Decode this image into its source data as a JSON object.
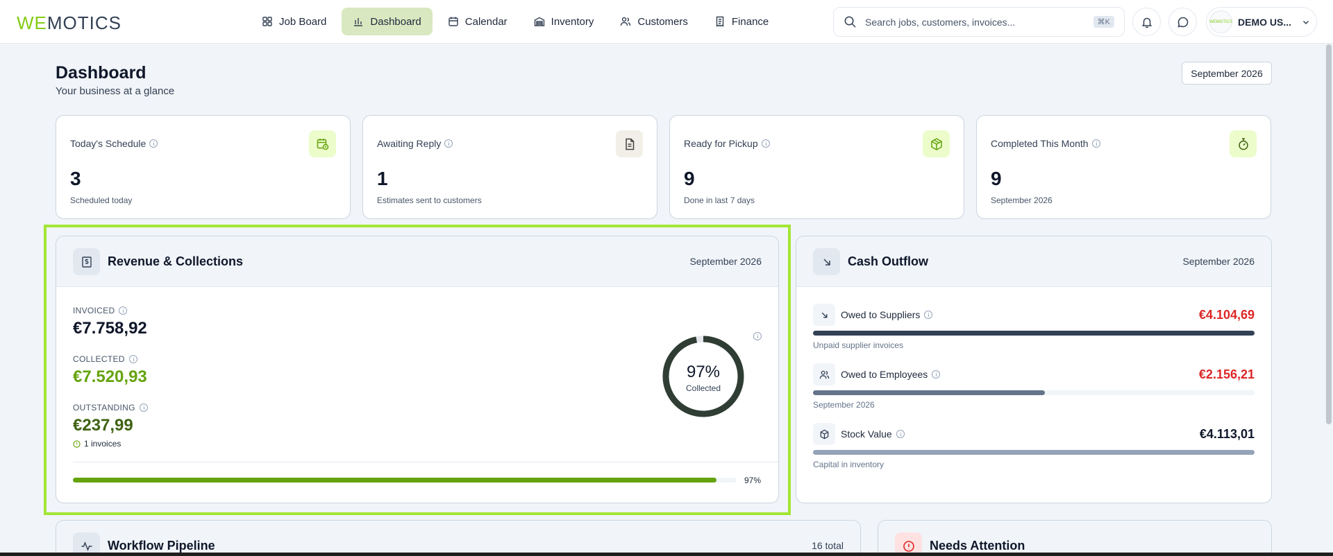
{
  "brand": {
    "logo_we": "WE",
    "logo_rest": "MOTICS",
    "accent": "#84cc16"
  },
  "nav": [
    {
      "label": "Job Board",
      "icon": "grid-icon",
      "active": false
    },
    {
      "label": "Dashboard",
      "icon": "bar-chart-icon",
      "active": true
    },
    {
      "label": "Calendar",
      "icon": "calendar-icon",
      "active": false
    },
    {
      "label": "Inventory",
      "icon": "warehouse-icon",
      "active": false
    },
    {
      "label": "Customers",
      "icon": "users-icon",
      "active": false
    },
    {
      "label": "Finance",
      "icon": "receipt-icon",
      "active": false
    }
  ],
  "search": {
    "placeholder": "Search jobs, customers, invoices...",
    "shortcut": "⌘K"
  },
  "user": {
    "name": "DEMO US...",
    "avatar_text": "WEMOTICS"
  },
  "header": {
    "title": "Dashboard",
    "subtitle": "Your business at a glance",
    "month": "September 2026"
  },
  "stats": [
    {
      "label": "Today's Schedule",
      "value": "3",
      "sub": "Scheduled today",
      "icon": "calendar-clock-icon",
      "icon_bg": "#ecfccb",
      "icon_color": "#65a30d"
    },
    {
      "label": "Awaiting Reply",
      "value": "1",
      "sub": "Estimates sent to customers",
      "icon": "document-icon",
      "icon_bg": "#f1efe8",
      "icon_color": "#44403c"
    },
    {
      "label": "Ready for Pickup",
      "value": "9",
      "sub": "Done in last 7 days",
      "icon": "package-icon",
      "icon_bg": "#ecfccb",
      "icon_color": "#65a30d"
    },
    {
      "label": "Completed This Month",
      "value": "9",
      "sub": "September 2026",
      "icon": "timer-icon",
      "icon_bg": "#ecfccb",
      "icon_color": "#3f6212"
    }
  ],
  "revenue": {
    "title": "Revenue & Collections",
    "period": "September 2026",
    "invoiced_label": "INVOICED",
    "invoiced_value": "€7.758,92",
    "collected_label": "COLLECTED",
    "collected_value": "€7.520,93",
    "outstanding_label": "OUTSTANDING",
    "outstanding_value": "€237,99",
    "outstanding_note": "1 invoices",
    "collected_pct_label": "97%",
    "collected_caption": "Collected",
    "collected_fraction": 0.97,
    "colors": {
      "collected": "#65a30d",
      "outstanding": "#3f6212",
      "donut": "#2f3d35"
    }
  },
  "cash_outflow": {
    "title": "Cash Outflow",
    "period": "September 2026",
    "rows": [
      {
        "label": "Owed to Suppliers",
        "amount": "€4.104,69",
        "sub": "Unpaid supplier invoices",
        "fraction": 1.0,
        "bar_color": "#334155",
        "amount_color": "#dc2626",
        "icon": "arrow-down-right-icon"
      },
      {
        "label": "Owed to Employees",
        "amount": "€2.156,21",
        "sub": "September 2026",
        "fraction": 0.525,
        "bar_color": "#64748b",
        "amount_color": "#dc2626",
        "icon": "users-icon"
      },
      {
        "label": "Stock Value",
        "amount": "€4.113,01",
        "sub": "Capital in inventory",
        "fraction": 1.0,
        "bar_color": "#94a3b8",
        "amount_color": "#0f172a",
        "icon": "box-icon"
      }
    ]
  },
  "pipeline": {
    "title": "Workflow Pipeline",
    "total": "16 total"
  },
  "attention": {
    "title": "Needs Attention"
  }
}
